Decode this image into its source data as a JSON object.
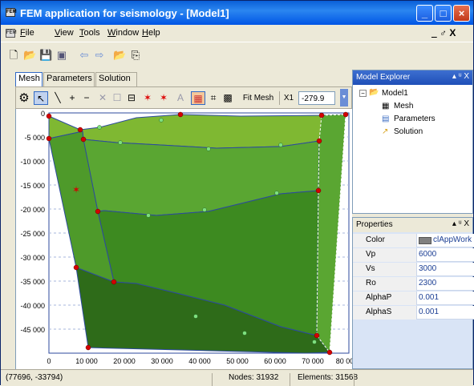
{
  "window": {
    "title": "FEM application for seismology - [Model1]",
    "app_icon": "fem-app-icon",
    "controls": [
      "_",
      "□",
      "×"
    ]
  },
  "menu": {
    "items": [
      "File",
      "View",
      "Tools",
      "Window",
      "Help"
    ],
    "mdi_controls": "_ ♂ X"
  },
  "tabs": [
    "Mesh",
    "Parameters",
    "Solution"
  ],
  "toolbar": {
    "fit_mesh_label": "Fit Mesh",
    "x1_label": "X1",
    "x1_value": "-279.9"
  },
  "plot": {
    "x_ticks": [
      "0",
      "10 000",
      "20 000",
      "30 000",
      "40 000",
      "50 000",
      "60 000",
      "70 000",
      "80 00"
    ],
    "y_ticks": [
      "0",
      "-5 000",
      "-10 000",
      "-15 000",
      "-20 000",
      "-25 000",
      "-30 000",
      "-35 000",
      "-40 000",
      "-45 000"
    ],
    "colors": {
      "top_layer": "#7fb832",
      "upper_band": "#5aa632",
      "middle_layer": "#3d8a20",
      "lower_layer": "#2e6b19",
      "left_block": "#4e9a2a",
      "right_block": "#5aa632",
      "boundary_lines": "#2c4a9e",
      "node_red": "#d40000",
      "node_green": "#7ee07e"
    }
  },
  "status": {
    "coords": "(77696, -33794)",
    "nodes": "Nodes: 31932",
    "elements": "Elements: 31568"
  },
  "explorer": {
    "title": "Model Explorer",
    "pin_close": "▴ ᵘ X",
    "root": "Model1",
    "children": [
      "Mesh",
      "Parameters",
      "Solution"
    ]
  },
  "properties": {
    "title": "Properties",
    "pin_close": "▴ ᵘ X",
    "rows": [
      {
        "name": "Color",
        "value": "clAppWork"
      },
      {
        "name": "Vp",
        "value": "6000"
      },
      {
        "name": "Vs",
        "value": "3000"
      },
      {
        "name": "Ro",
        "value": "2300"
      },
      {
        "name": "AlphaP",
        "value": "0.001"
      },
      {
        "name": "AlphaS",
        "value": "0.001"
      }
    ]
  }
}
